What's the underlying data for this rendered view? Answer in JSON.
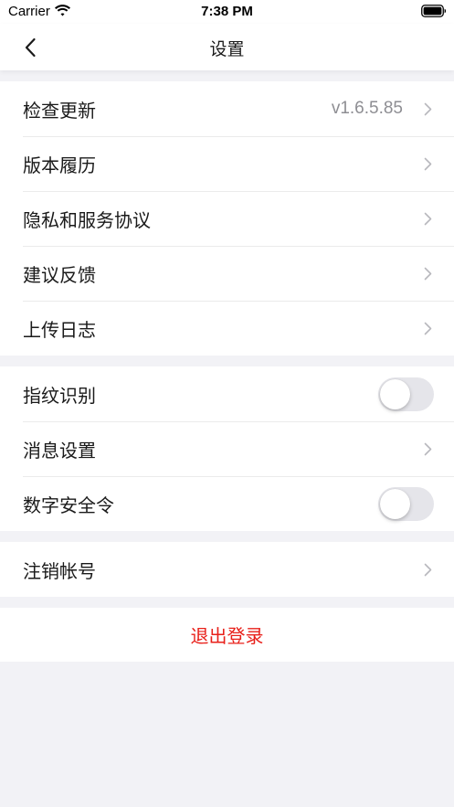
{
  "status_bar": {
    "carrier": "Carrier",
    "time": "7:38 PM"
  },
  "header": {
    "title": "设置",
    "back_icon": "chevron-left-icon"
  },
  "groups": [
    {
      "items": [
        {
          "label": "检查更新",
          "value": "v1.6.5.85",
          "accessory": "chevron"
        },
        {
          "label": "版本履历",
          "accessory": "chevron"
        },
        {
          "label": "隐私和服务协议",
          "accessory": "chevron"
        },
        {
          "label": "建议反馈",
          "accessory": "chevron"
        },
        {
          "label": "上传日志",
          "accessory": "chevron"
        }
      ]
    },
    {
      "items": [
        {
          "label": "指纹识别",
          "accessory": "toggle",
          "on": false
        },
        {
          "label": "消息设置",
          "accessory": "chevron"
        },
        {
          "label": "数字安全令",
          "accessory": "toggle",
          "on": false
        }
      ]
    },
    {
      "items": [
        {
          "label": "注销帐号",
          "accessory": "chevron"
        }
      ]
    }
  ],
  "logout": {
    "label": "退出登录"
  },
  "colors": {
    "background": "#f2f2f6",
    "surface": "#ffffff",
    "text": "#1a1a1a",
    "secondary_text": "#8e8e93",
    "chevron": "#b8b8bd",
    "danger": "#e8201a",
    "toggle_off": "#e5e5ea"
  }
}
